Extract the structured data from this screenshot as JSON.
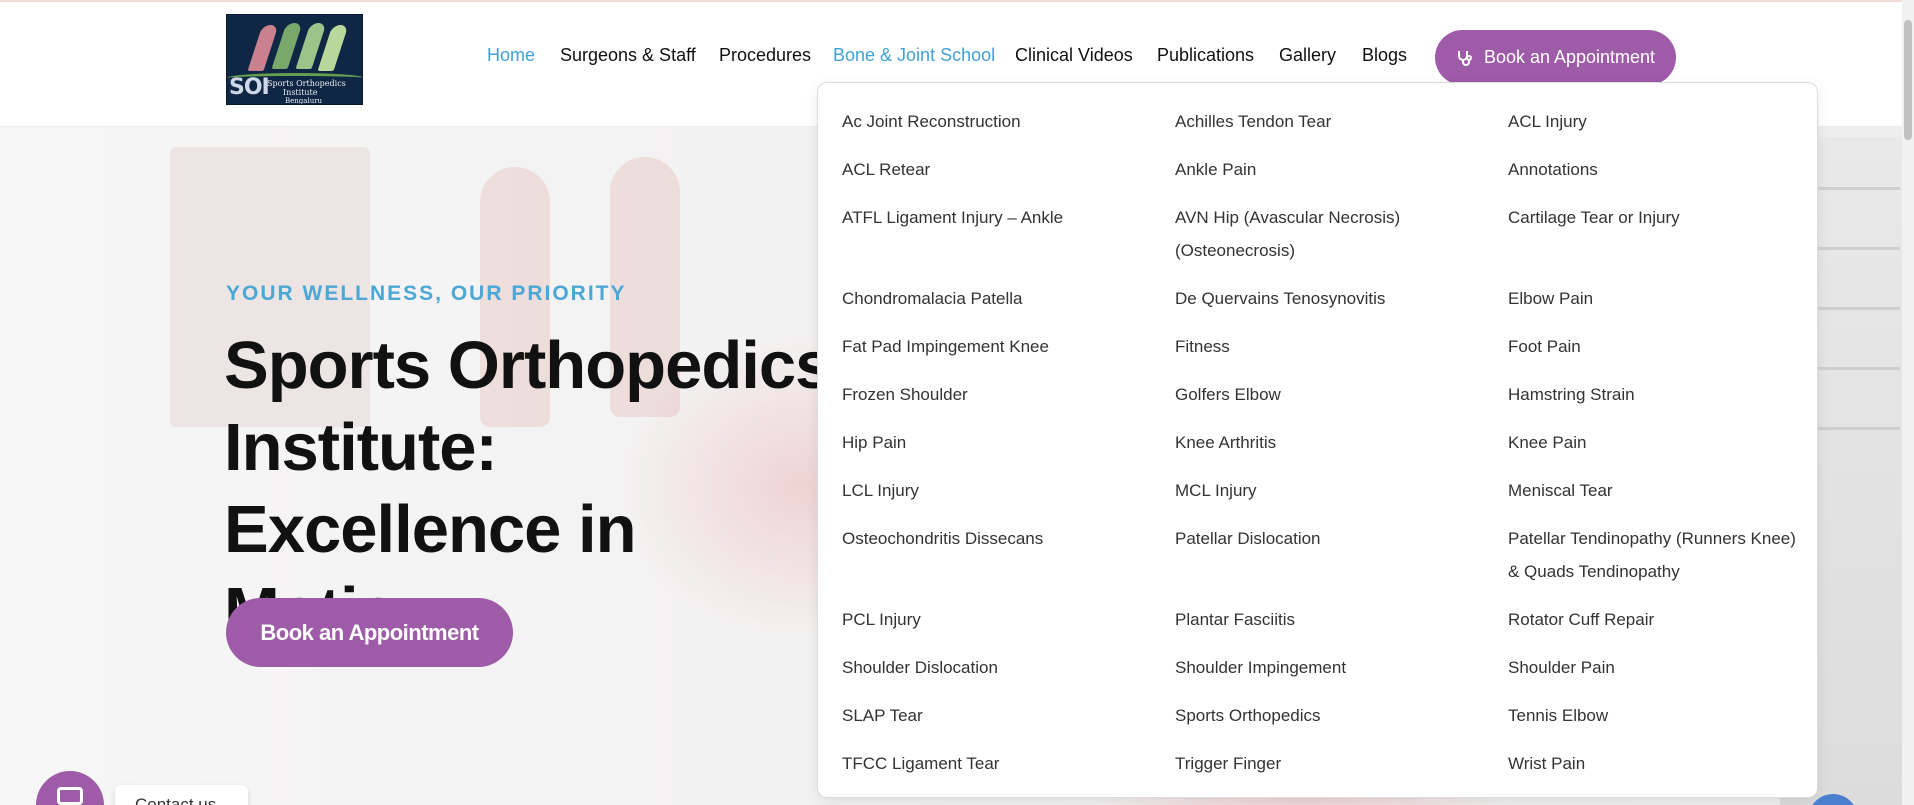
{
  "nav": {
    "items": [
      {
        "label": "Home",
        "active": true
      },
      {
        "label": "Surgeons & Staff",
        "active": false
      },
      {
        "label": "Procedures",
        "active": false
      },
      {
        "label": "Bone & Joint School",
        "active": true
      },
      {
        "label": "Clinical Videos",
        "active": false
      },
      {
        "label": "Publications",
        "active": false
      },
      {
        "label": "Gallery",
        "active": false
      },
      {
        "label": "Blogs",
        "active": false
      }
    ],
    "cta_label": "Book an Appointment",
    "cta_icon": "stethoscope-icon"
  },
  "logo": {
    "abbr": "SOI",
    "line1": "Sports Orthopedics",
    "line2": "Institute",
    "line3": "Bengaluru"
  },
  "hero": {
    "tagline": "YOUR WELLNESS, OUR PRIORITY",
    "title": "Sports Orthopedics\nInstitute: Excellence in\nMotion",
    "button_label": "Book an Appointment"
  },
  "dropdown": {
    "columns": [
      [
        "Ac Joint Reconstruction",
        "ACL Retear",
        "ATFL Ligament Injury – Ankle",
        "Chondromalacia Patella",
        "Fat Pad Impingement Knee",
        "Frozen Shoulder",
        "Hip Pain",
        "LCL Injury",
        "Osteochondritis Dissecans",
        "PCL Injury",
        "Shoulder Dislocation",
        "SLAP Tear",
        "TFCC Ligament Tear"
      ],
      [
        "Achilles Tendon Tear",
        "Ankle Pain",
        "AVN Hip (Avascular Necrosis) (Osteonecrosis)",
        "De Quervains Tenosynovitis",
        "Fitness",
        "Golfers Elbow",
        "Knee Arthritis",
        "MCL Injury",
        "Patellar Dislocation",
        "Plantar Fasciitis",
        "Shoulder Impingement",
        "Sports Orthopedics",
        "Trigger Finger"
      ],
      [
        "ACL Injury",
        "Annotations",
        "Cartilage Tear or Injury",
        "Elbow Pain",
        "Foot Pain",
        "Hamstring Strain",
        "Knee Pain",
        "Meniscal Tear",
        "Patellar Tendinopathy (Runners Knee) & Quads Tendinopathy",
        "Rotator Cuff Repair",
        "Shoulder Pain",
        "Tennis Elbow",
        "Wrist Pain"
      ]
    ]
  },
  "widgets": {
    "contact_label": "Contact us",
    "chat_icon": "chat-icon"
  },
  "colors": {
    "accent": "#9e5ba8",
    "link_active": "#3fa2d4"
  }
}
